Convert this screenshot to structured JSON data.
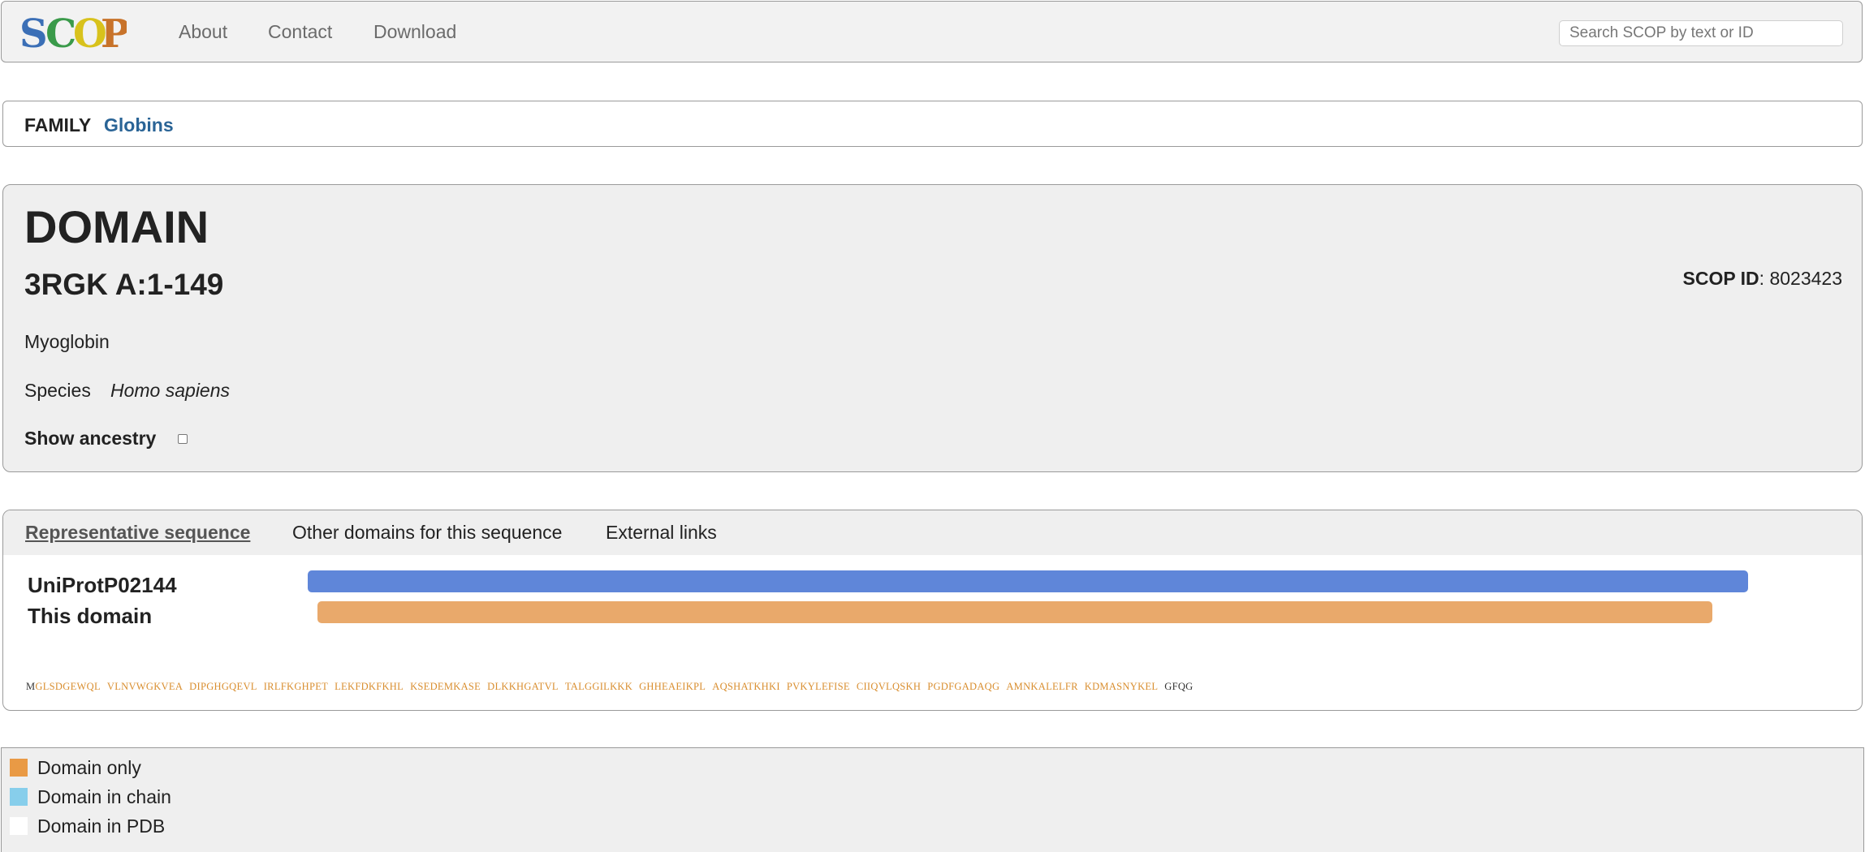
{
  "nav": {
    "logo_text": "SCOP",
    "links": [
      "About",
      "Contact",
      "Download"
    ],
    "search_placeholder": "Search SCOP by text or ID"
  },
  "breadcrumb": {
    "level": "FAMILY",
    "name": "Globins"
  },
  "domain": {
    "heading": "DOMAIN",
    "id": "3RGK A:1-149",
    "scop_id_label": "SCOP ID",
    "scop_id_value": ": 8023423",
    "protein": "Myoglobin",
    "species_label": "Species",
    "species": "Homo sapiens",
    "ancestry_label": "Show ancestry",
    "ancestry_checked": false
  },
  "tabs": [
    "Representative sequence",
    "Other domains for this sequence",
    "External links"
  ],
  "sequence": {
    "rows": [
      {
        "label": "UniProtP02144",
        "color": "#5f86d9"
      },
      {
        "label": "This domain",
        "color": "#e9a96b"
      }
    ],
    "residues_start": "M",
    "residues_domain": [
      "GLSDGEWQL",
      "VLNVWGKVEA",
      "DIPGHGQEVL",
      "IRLFKGHPET",
      "LEKFDKFKHL",
      "KSEDEMKASE",
      "DLKKHGATVL",
      "TALGGILKKK",
      "GHHEAEIKPL",
      "AQSHATKHKI",
      "PVKYLEFISE",
      "CIIQVLQSKH",
      "PGDFGADAQG",
      "AMNKALELFR",
      "KDMASNYKEL"
    ],
    "residues_end": "GFQG",
    "domain_color": "#d98e2f",
    "other_color": "#333333"
  },
  "legend": [
    {
      "label": "Domain only",
      "color": "#e99a45"
    },
    {
      "label": "Domain in chain",
      "color": "#87ceeb"
    },
    {
      "label": "Domain in PDB",
      "color": "#ffffff"
    }
  ]
}
